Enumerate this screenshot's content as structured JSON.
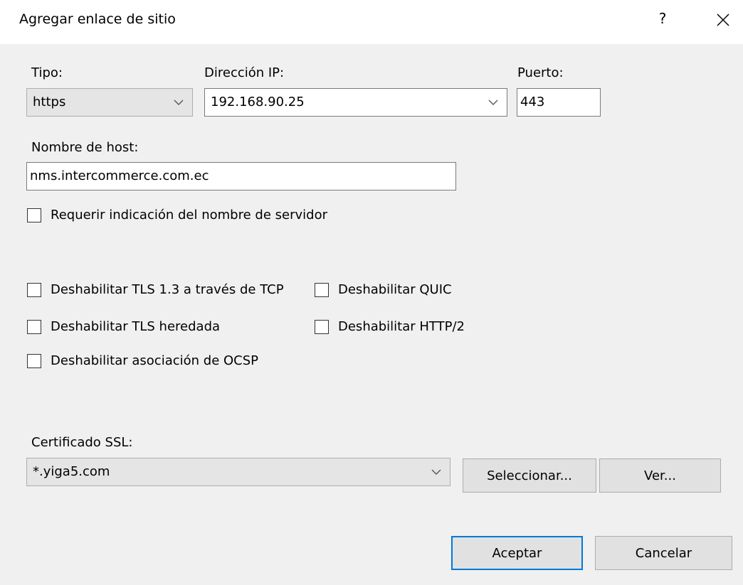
{
  "dialog": {
    "title": "Agregar enlace de sitio",
    "help_label": "?"
  },
  "type": {
    "label": "Tipo:",
    "value": "https"
  },
  "ip": {
    "label": "Dirección IP:",
    "value": "192.168.90.25"
  },
  "port": {
    "label": "Puerto:",
    "value": "443"
  },
  "host": {
    "label": "Nombre de host:",
    "value": "nms.intercommerce.com.ec"
  },
  "checkboxes": {
    "require_sni": {
      "label": "Requerir indicación del nombre de servidor",
      "checked": false
    },
    "disable_tls13_tcp": {
      "label": "Deshabilitar TLS 1.3 a través de TCP",
      "checked": false
    },
    "disable_quic": {
      "label": "Deshabilitar QUIC",
      "checked": false
    },
    "disable_legacy_tls": {
      "label": "Deshabilitar TLS heredada",
      "checked": false
    },
    "disable_http2": {
      "label": "Deshabilitar HTTP/2",
      "checked": false
    },
    "disable_ocsp": {
      "label": "Deshabilitar asociación de OCSP",
      "checked": false
    }
  },
  "ssl": {
    "label": "Certificado SSL:",
    "value": "*.yiga5.com"
  },
  "buttons": {
    "select": "Seleccionar...",
    "view": "Ver...",
    "ok": "Aceptar",
    "cancel": "Cancelar"
  },
  "colors": {
    "accent": "#0078d7",
    "background": "#f0f0f0"
  }
}
